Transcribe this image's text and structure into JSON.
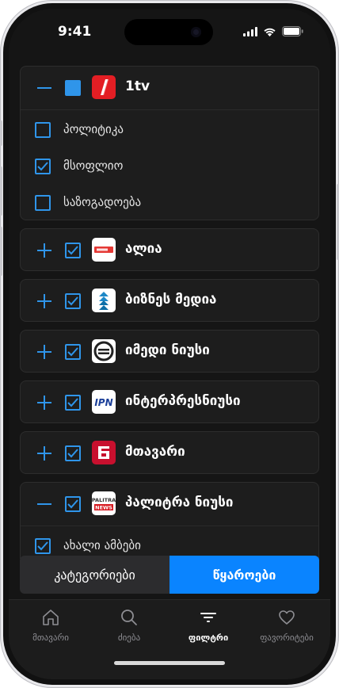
{
  "status_bar": {
    "time": "9:41"
  },
  "sources": [
    {
      "title": "1tv",
      "expanded": true,
      "checked": "partial",
      "categories": [
        {
          "label": "პოლიტიკა",
          "checked": false
        },
        {
          "label": "მსოფლიო",
          "checked": true
        },
        {
          "label": "საზოგადოება",
          "checked": false
        }
      ]
    },
    {
      "title": "ალია",
      "expanded": false,
      "checked": true
    },
    {
      "title": "ბიზნეს მედია",
      "expanded": false,
      "checked": true
    },
    {
      "title": "იმედი ნიუსი",
      "expanded": false,
      "checked": true
    },
    {
      "title": "ინტერპრესნიუსი",
      "expanded": false,
      "checked": true
    },
    {
      "title": "მთავარი",
      "expanded": false,
      "checked": true
    },
    {
      "title": "პალიტრა ნიუსი",
      "expanded": true,
      "checked": true,
      "logo_text": [
        "PALITRA",
        "NEWS"
      ],
      "categories": [
        {
          "label": "ახალი ამბები",
          "checked": true
        }
      ]
    }
  ],
  "logos": {
    "ipn_text": "IPN"
  },
  "segmented": {
    "categories_label": "კატეგორიები",
    "sources_label": "წყაროები",
    "selected": "sources"
  },
  "tabs": [
    {
      "label": "მთავარი",
      "icon": "home-icon"
    },
    {
      "label": "ძიება",
      "icon": "search-icon"
    },
    {
      "label": "ფილტრი",
      "icon": "filter-icon",
      "active": true
    },
    {
      "label": "ფავორიტები",
      "icon": "heart-icon"
    }
  ],
  "colors": {
    "accent": "#2f95ea",
    "segment_active": "#0a84ff",
    "background": "#151515"
  }
}
